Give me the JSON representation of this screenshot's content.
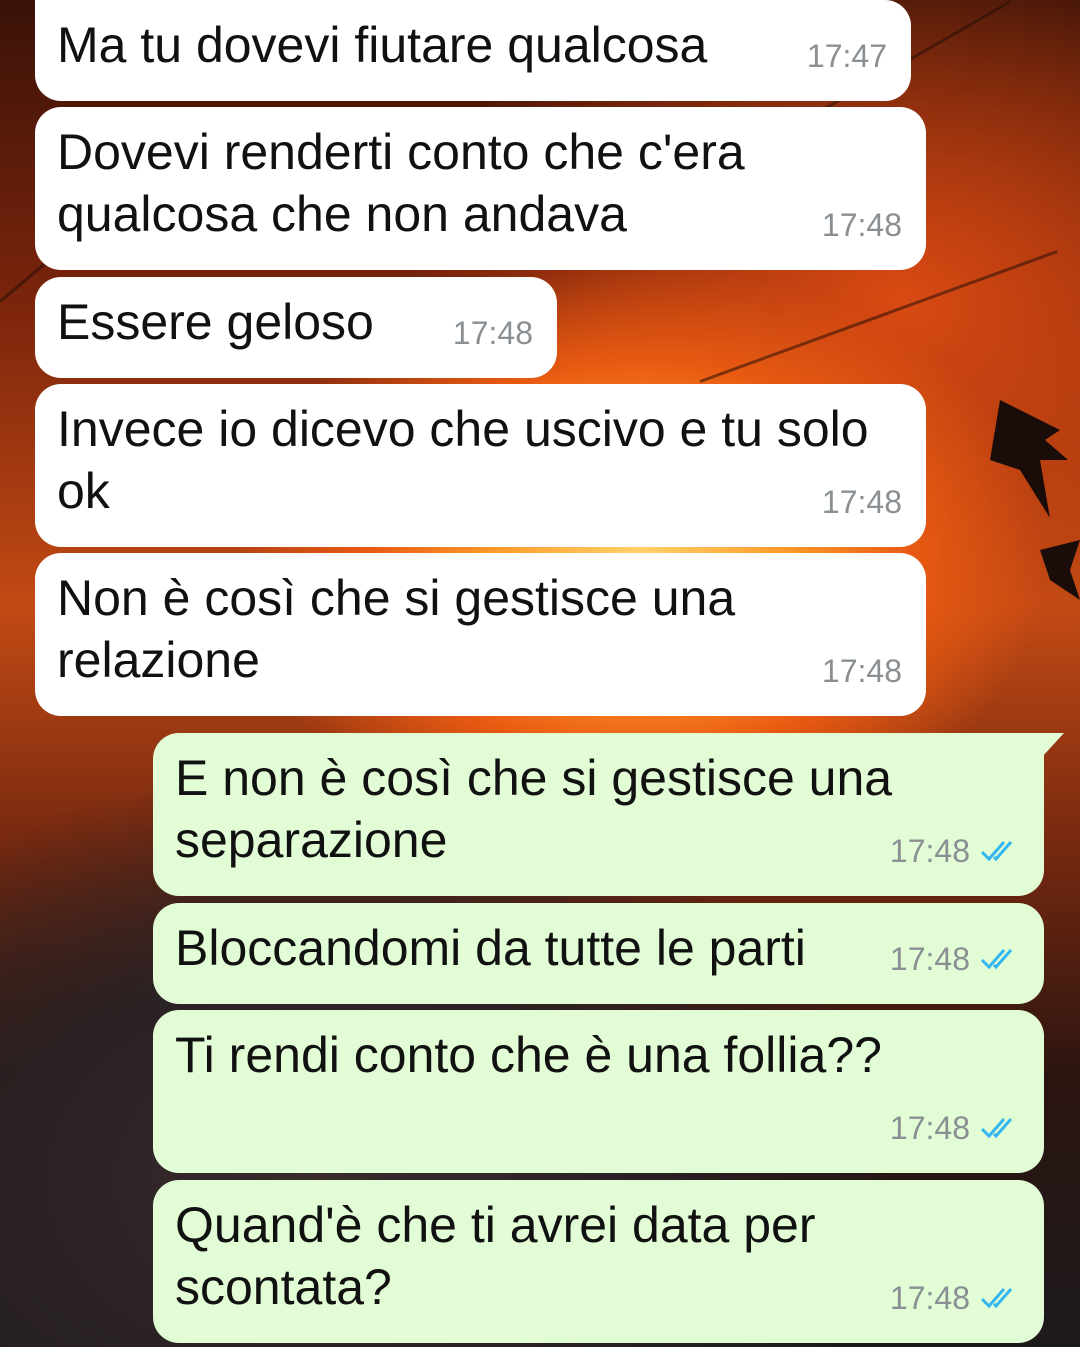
{
  "colors": {
    "incoming_bubble": "#ffffff",
    "outgoing_bubble": "#e2fdd6",
    "timestamp": "#8a8f93",
    "read_ticks": "#34b7f1"
  },
  "messages": [
    {
      "direction": "incoming",
      "text": "Ma tu dovevi fiutare qualcosa",
      "time": "17:47"
    },
    {
      "direction": "incoming",
      "text": "Dovevi renderti conto che c'era\nqualcosa che non andava",
      "time": "17:48"
    },
    {
      "direction": "incoming",
      "text": "Essere geloso",
      "time": "17:48"
    },
    {
      "direction": "incoming",
      "text": "Invece io dicevo che uscivo e tu solo\nok",
      "time": "17:48"
    },
    {
      "direction": "incoming",
      "text": "Non è così che si gestisce una\nrelazione",
      "time": "17:48"
    },
    {
      "direction": "outgoing",
      "text": "E non è così che si gestisce una\nseparazione",
      "time": "17:48",
      "status_icon": "double-check-read-icon"
    },
    {
      "direction": "outgoing",
      "text": "Bloccandomi da tutte le parti",
      "time": "17:48",
      "status_icon": "double-check-read-icon"
    },
    {
      "direction": "outgoing",
      "text": "Ti rendi conto che è una follia??",
      "time": "17:48",
      "status_icon": "double-check-read-icon"
    },
    {
      "direction": "outgoing",
      "text": "Quand'è che ti avrei data per\nscontata?",
      "time": "17:48",
      "status_icon": "double-check-read-icon"
    }
  ]
}
